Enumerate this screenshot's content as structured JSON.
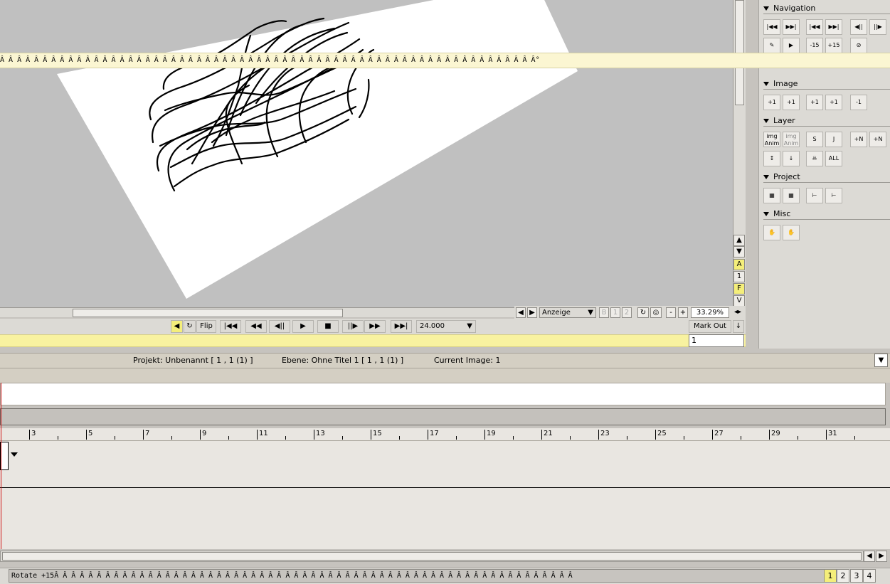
{
  "overlay_text": "Â Â Â Â Â Â Â Â Â Â Â Â Â Â Â Â Â Â Â Â Â Â Â Â Â Â Â Â Â Â Â Â Â Â Â Â Â Â Â Â Â Â Â Â Â Â Â Â Â Â Â Â Â Â Â Â Â Â Â Â Â Â Â°",
  "panel": {
    "navigation": "Navigation",
    "image": "Image",
    "layer": "Layer",
    "project": "Project",
    "misc": "Misc",
    "img_anim_1": "img Anim",
    "img_anim_2": "img Anim",
    "plus1": "+1",
    "minus1": "-1",
    "all": "ALL",
    "n1": "+N",
    "n2": "+N",
    "m15": "-15",
    "p15": "+15"
  },
  "vside": {
    "a": "A",
    "one": "1",
    "f": "F",
    "v": "V"
  },
  "viewbar": {
    "display_select": "Anzeige",
    "b": "B",
    "one": "1",
    "two": "2",
    "minus": "-",
    "plus": "+",
    "zoom": "33.29%"
  },
  "transport": {
    "flip": "Flip",
    "fps": "24.000",
    "mark_out": "Mark Out"
  },
  "frame_value": "1",
  "status": {
    "project": "Projekt: Unbenannt [ 1 ,  1  (1) ]",
    "layer": "Ebene: Ohne Titel 1 [ 1 ,  1  (1) ]",
    "current_image": "Current Image: 1"
  },
  "ruler_labels": [
    "3",
    "5",
    "7",
    "9",
    "11",
    "13",
    "15",
    "17",
    "19",
    "21",
    "23",
    "25",
    "27",
    "29",
    "31"
  ],
  "bottom": {
    "text": "Rotate +15Â Â Â Â Â Â Â Â Â Â Â Â Â Â Â Â Â Â Â Â Â Â Â Â Â Â Â Â Â Â Â Â Â Â Â Â Â Â Â Â Â Â Â Â Â Â Â Â Â Â Â Â Â Â Â Â Â Â Â Â Â ",
    "pages": [
      "1",
      "2",
      "3",
      "4"
    ]
  },
  "colors": {
    "accent_yellow": "#f4ee7a",
    "timeline_marker": "#d01818"
  }
}
